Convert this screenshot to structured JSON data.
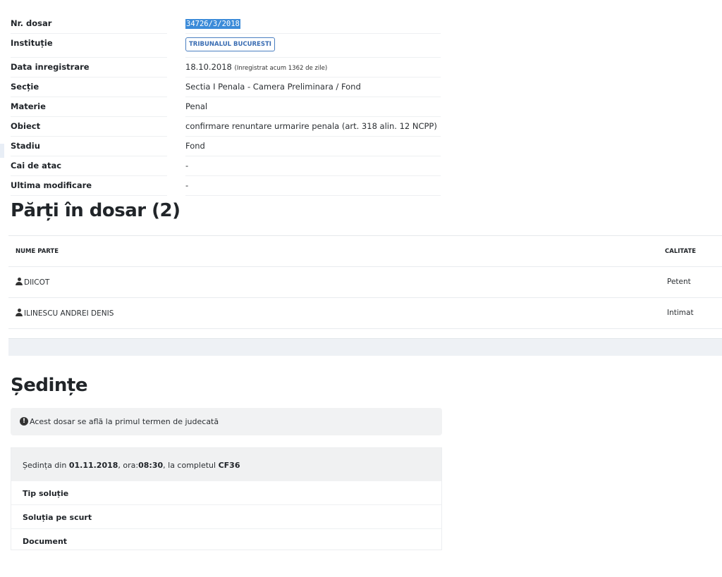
{
  "details": {
    "rows": [
      {
        "label": "Nr. dosar",
        "value": "34726/3/2018"
      },
      {
        "label": "Instituție",
        "value": "TRIBUNALUL BUCURESTI"
      },
      {
        "label": "Data inregistrare",
        "value": "18.10.2018",
        "extra": "(Inregistrat acum 1362 de zile)"
      },
      {
        "label": "Secție",
        "value": "Sectia I Penala - Camera Preliminara / Fond"
      },
      {
        "label": "Materie",
        "value": "Penal"
      },
      {
        "label": "Obiect",
        "value": "confirmare renuntare urmarire penala (art. 318 alin. 12 NCPP)"
      },
      {
        "label": "Stadiu",
        "value": "Fond"
      },
      {
        "label": "Cai de atac",
        "value": "-"
      },
      {
        "label": "Ultima modificare",
        "value": "-"
      }
    ]
  },
  "parties": {
    "title": "Părți în dosar (2)",
    "columns": {
      "name": "NUME PARTE",
      "role": "CALITATE"
    },
    "rows": [
      {
        "name": "DIICOT",
        "role": "Petent",
        "icon": "user-icon"
      },
      {
        "name": "ILINESCU ANDREI DENIS",
        "role": "Intimat",
        "icon": "user-icon"
      }
    ]
  },
  "sessions": {
    "title": "Ședințe",
    "alert": {
      "icon": "info-circle-icon",
      "text": "Acest dosar se află la primul termen de judecată"
    },
    "session": {
      "prefix": "Ședința din ",
      "date": "01.11.2018",
      "mid": ", ora:",
      "time": "08:30",
      "mid2": ", la completul ",
      "panel": "CF36",
      "rows": [
        "Tip soluție",
        "Soluția pe scurt",
        "Document"
      ]
    }
  },
  "colors": {
    "badge": "#3a6db3",
    "selection": "#3b8bd9",
    "band": "#eef1f5"
  }
}
